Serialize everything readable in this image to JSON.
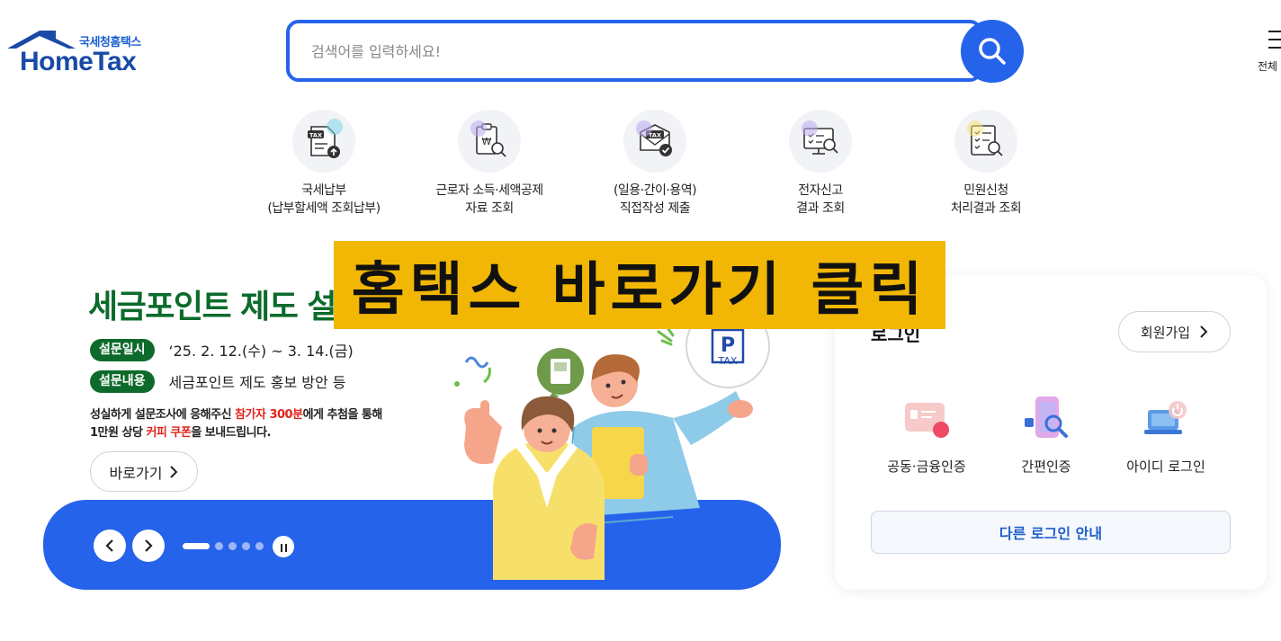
{
  "header": {
    "logo_sub": "국세청홈택스",
    "logo_main": "HomeTax",
    "search_placeholder": "검색어를 입력하세요!",
    "menu_label": "전체"
  },
  "quick_menu": [
    {
      "line1": "국세납부",
      "line2": "(납부할세액 조회납부)",
      "icon": "tax-upload-icon",
      "accent": "#7fd3ea"
    },
    {
      "line1": "근로자 소득·세액공제",
      "line2": "자료 조회",
      "icon": "won-document-search-icon",
      "accent": "#b9a8f0"
    },
    {
      "line1": "(일용·간이·용역)",
      "line2": "직접작성 제출",
      "icon": "tax-check-icon",
      "accent": "#b9a8f0"
    },
    {
      "line1": "전자신고",
      "line2": "결과 조회",
      "icon": "monitor-search-icon",
      "accent": "#b9a8f0"
    },
    {
      "line1": "민원신청",
      "line2": "처리결과 조회",
      "icon": "checklist-search-icon",
      "accent": "#f5e27a"
    }
  ],
  "banner": {
    "title": "세금포인트 제도 설문조사",
    "period_label": "설문일시",
    "period_value": "‘25. 2. 12.(수) ~ 3. 14.(금)",
    "content_label": "설문내용",
    "content_value": "세금포인트 제도 홍보 방안 등",
    "desc1_a": "성실하게 설문조사에 응해주신 ",
    "desc1_red": "참가자 300분",
    "desc1_b": "에게 추첨을 통해",
    "desc2_a": "1만원 상당 ",
    "desc2_red": "커피 쿠폰",
    "desc2_b": "을 보내드립니다.",
    "go_label": "바로가기",
    "badge_letter": "P",
    "badge_text": "TAX",
    "slide_count": 5,
    "active_slide": 1
  },
  "login": {
    "title": "로그인",
    "join_label": "회원가입",
    "options": [
      {
        "label": "공동·금융인증",
        "icon": "certificate-icon"
      },
      {
        "label": "간편인증",
        "icon": "phone-search-icon"
      },
      {
        "label": "아이디 로그인",
        "icon": "laptop-power-icon"
      }
    ],
    "other_label": "다른 로그인 안내"
  },
  "overlay_caption": "홈택스 바로가기 클릭",
  "colors": {
    "brand_blue": "#2563eb",
    "banner_green": "#0b6b2b",
    "highlight_red": "#e0251b",
    "caption_yellow": "#f2b705"
  }
}
